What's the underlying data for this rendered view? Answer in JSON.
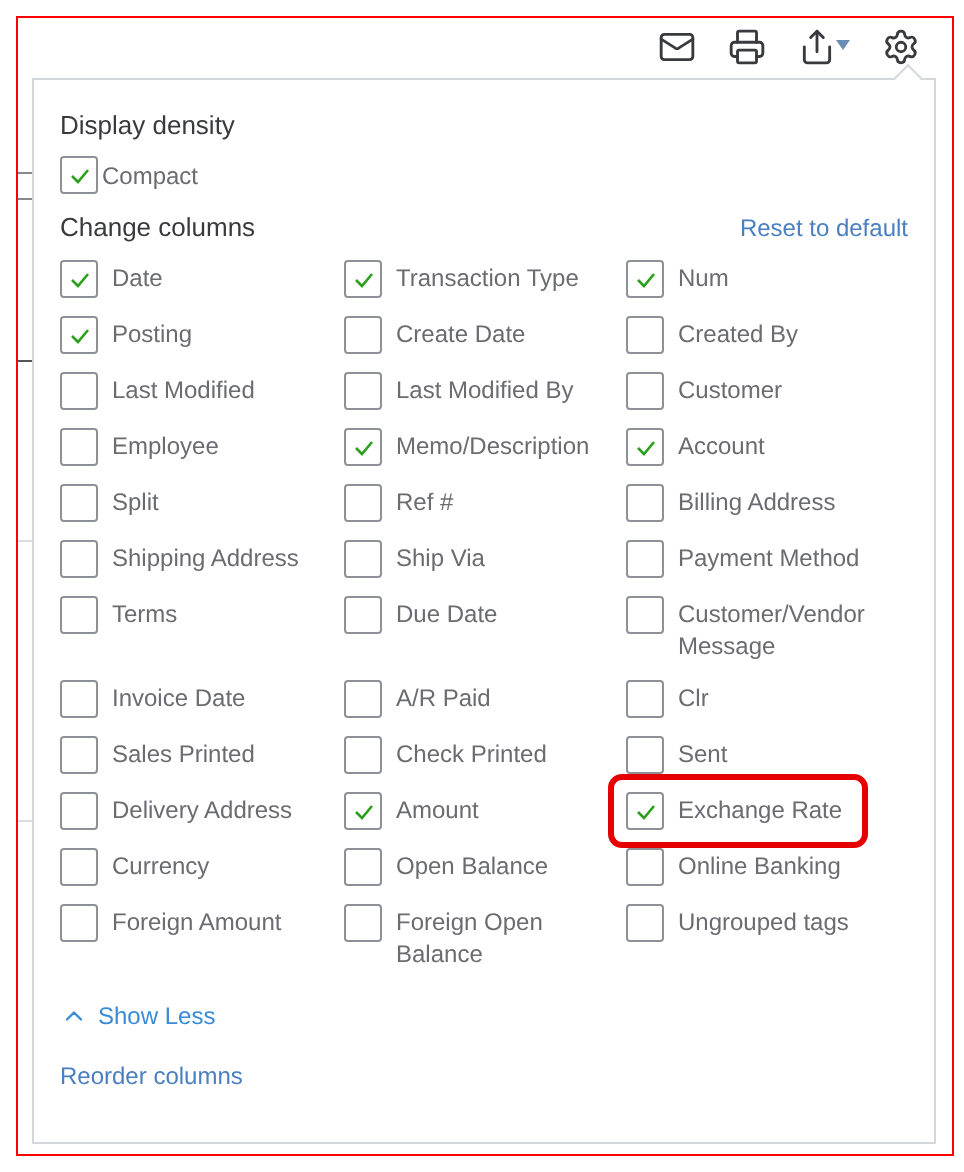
{
  "toolbar": {
    "icons": [
      {
        "kind": "mail"
      },
      {
        "kind": "print"
      },
      {
        "kind": "export"
      },
      {
        "kind": "settings"
      }
    ]
  },
  "popup": {
    "density_title": "Display density",
    "compact": {
      "label": "Compact",
      "checked": true
    },
    "columns_title": "Change columns",
    "reset_link": "Reset to default",
    "columns": [
      {
        "label": "Date",
        "checked": true,
        "highlighted": false
      },
      {
        "label": "Transaction Type",
        "checked": true,
        "highlighted": false
      },
      {
        "label": "Num",
        "checked": true,
        "highlighted": false
      },
      {
        "label": "Posting",
        "checked": true,
        "highlighted": false
      },
      {
        "label": "Create Date",
        "checked": false,
        "highlighted": false
      },
      {
        "label": "Created By",
        "checked": false,
        "highlighted": false
      },
      {
        "label": "Last Modified",
        "checked": false,
        "highlighted": false
      },
      {
        "label": "Last Modified By",
        "checked": false,
        "highlighted": false
      },
      {
        "label": "Customer",
        "checked": false,
        "highlighted": false
      },
      {
        "label": "Employee",
        "checked": false,
        "highlighted": false
      },
      {
        "label": "Memo/Description",
        "checked": true,
        "highlighted": false
      },
      {
        "label": "Account",
        "checked": true,
        "highlighted": false
      },
      {
        "label": "Split",
        "checked": false,
        "highlighted": false
      },
      {
        "label": "Ref #",
        "checked": false,
        "highlighted": false
      },
      {
        "label": "Billing Address",
        "checked": false,
        "highlighted": false
      },
      {
        "label": "Shipping Address",
        "checked": false,
        "highlighted": false
      },
      {
        "label": "Ship Via",
        "checked": false,
        "highlighted": false
      },
      {
        "label": "Payment Method",
        "checked": false,
        "highlighted": false
      },
      {
        "label": "Terms",
        "checked": false,
        "highlighted": false
      },
      {
        "label": "Due Date",
        "checked": false,
        "highlighted": false
      },
      {
        "label": "Customer/Vendor Message",
        "checked": false,
        "highlighted": false
      },
      {
        "label": "Invoice Date",
        "checked": false,
        "highlighted": false
      },
      {
        "label": "A/R Paid",
        "checked": false,
        "highlighted": false
      },
      {
        "label": "Clr",
        "checked": false,
        "highlighted": false
      },
      {
        "label": "Sales Printed",
        "checked": false,
        "highlighted": false
      },
      {
        "label": "Check Printed",
        "checked": false,
        "highlighted": false
      },
      {
        "label": "Sent",
        "checked": false,
        "highlighted": false
      },
      {
        "label": "Delivery Address",
        "checked": false,
        "highlighted": false
      },
      {
        "label": "Amount",
        "checked": true,
        "highlighted": false
      },
      {
        "label": "Exchange Rate",
        "checked": true,
        "highlighted": true
      },
      {
        "label": "Currency",
        "checked": false,
        "highlighted": false
      },
      {
        "label": "Open Balance",
        "checked": false,
        "highlighted": false
      },
      {
        "label": "Online Banking",
        "checked": false,
        "highlighted": false
      },
      {
        "label": "Foreign Amount",
        "checked": false,
        "highlighted": false
      },
      {
        "label": "Foreign Open Balance",
        "checked": false,
        "highlighted": false
      },
      {
        "label": "Ungrouped tags",
        "checked": false,
        "highlighted": false
      }
    ],
    "show_less": "Show Less",
    "reorder_link": "Reorder columns"
  }
}
